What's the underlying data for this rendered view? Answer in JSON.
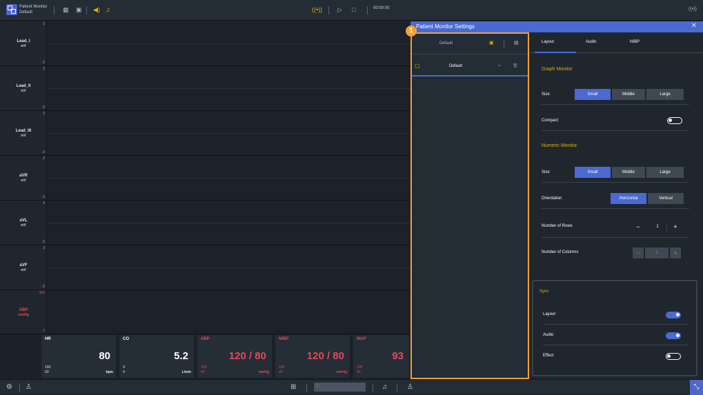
{
  "app": {
    "title_line1": "Patient Monitor",
    "title_line2": "Default"
  },
  "toolbar": {
    "timer": "00:00:00"
  },
  "graphs": [
    {
      "name": "Lead_I",
      "unit": "mV",
      "max": "2",
      "min": "-2"
    },
    {
      "name": "Lead_II",
      "unit": "mV",
      "max": "2",
      "min": "-2"
    },
    {
      "name": "Lead_III",
      "unit": "mV",
      "max": "2",
      "min": "-2"
    },
    {
      "name": "aVR",
      "unit": "mV",
      "max": "2",
      "min": "-2"
    },
    {
      "name": "aVL",
      "unit": "mV",
      "max": "2",
      "min": "-2"
    },
    {
      "name": "aVF",
      "unit": "mV",
      "max": "2",
      "min": "-2"
    },
    {
      "name": "ABP",
      "unit": "mmHg",
      "max": "300",
      "min": "0"
    }
  ],
  "numerics": [
    {
      "label": "HR",
      "value": "80",
      "high": "150",
      "low": "50",
      "unit": "bpm"
    },
    {
      "label": "CO",
      "value": "5.2",
      "high": "9",
      "low": "4",
      "unit": "L/min"
    },
    {
      "label": "ABP",
      "value": "120 / 80",
      "high": "160",
      "low": "40",
      "unit": "mmHg"
    },
    {
      "label": "NIBP",
      "value": "120 / 80",
      "high": "160",
      "low": "40",
      "unit": "mmHg"
    },
    {
      "label": "MAP",
      "value": "93",
      "high": "100",
      "low": "60",
      "unit": ""
    }
  ],
  "settings_panel": {
    "title": "Patient Monitor Settings",
    "marker": "1",
    "profiles": {
      "header": "Default",
      "items": [
        {
          "name": "Default"
        }
      ]
    },
    "tabs": [
      "Layout",
      "Audio",
      "NIBP"
    ],
    "graph_monitor": {
      "title": "Graph Monitor",
      "size_label": "Size",
      "size_options": [
        "Small",
        "Middle",
        "Large"
      ],
      "compact_label": "Compact"
    },
    "numeric_monitor": {
      "title": "Numeric Monitor",
      "size_label": "Size",
      "size_options": [
        "Small",
        "Middle",
        "Large"
      ],
      "orientation_label": "Orientation",
      "orientation_options": [
        "Horizontal",
        "Vertical"
      ],
      "rows_label": "Number of Rows",
      "rows_value": "1",
      "columns_label": "Number of Columns",
      "columns_value": "1"
    },
    "sync": {
      "title": "Sync",
      "layout_label": "Layout",
      "audio_label": "Audio",
      "effect_label": "Effect"
    }
  },
  "colors": {
    "accent": "#4b6ad1",
    "warning": "#e6b000",
    "alarm": "#e24a55",
    "highlight": "#f5a030"
  }
}
